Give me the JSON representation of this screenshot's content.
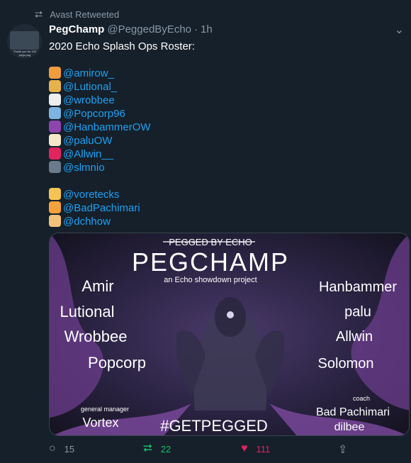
{
  "retweet_context": "Avast Retweeted",
  "author": {
    "name": "PegChamp",
    "handle": "@PeggedByEcho",
    "dot": "·",
    "time": "1h",
    "avatar_caption": "Thank you for 100 pegs pog"
  },
  "tweet": {
    "heading": "2020 Echo Splash Ops Roster:",
    "roster": [
      {
        "icon": "person-orange-icon",
        "mention": "@amirow_"
      },
      {
        "icon": "money-bag-icon",
        "mention": "@Lutional_"
      },
      {
        "icon": "goat-icon",
        "mention": "@wrobbee"
      },
      {
        "icon": "wizard-icon",
        "mention": "@Popcorp96"
      },
      {
        "icon": "eggplant-icon",
        "mention": "@HanbammerOW"
      },
      {
        "icon": "bone-icon",
        "mention": "@paluOW"
      },
      {
        "icon": "no-phone-icon",
        "mention": "@Allwin__"
      },
      {
        "icon": "spy-icon",
        "mention": "@slmnio"
      }
    ],
    "staff": [
      {
        "icon": "baby-icon",
        "mention": "@voretecks"
      },
      {
        "icon": "face-with-bandage-icon",
        "mention": "@BadPachimari"
      },
      {
        "icon": "ear-icon",
        "mention": "@dchhow"
      }
    ]
  },
  "image": {
    "top_label": "PEGGED BY ECHO",
    "title": "PEGCHAMP",
    "subtitle": "an Echo showdown project",
    "left_names": [
      "Amir",
      "Lutional",
      "Wrobbee",
      "Popcorp"
    ],
    "right_names": [
      "Hanbammer",
      "palu",
      "Allwin",
      "Solomon"
    ],
    "gm_label": "general manager",
    "gm_name": "Vortex",
    "coach_label": "coach",
    "coach_names": [
      "Bad Pachimari",
      "dilbee"
    ],
    "hashtag": "#GETPEGGED"
  },
  "actions": {
    "replies": "15",
    "retweets": "22",
    "likes": "111"
  },
  "colors": {
    "background": "#15202b",
    "link": "#1da1f2",
    "muted": "#8899a6",
    "retweet": "#17bf63",
    "like": "#e0245e"
  }
}
